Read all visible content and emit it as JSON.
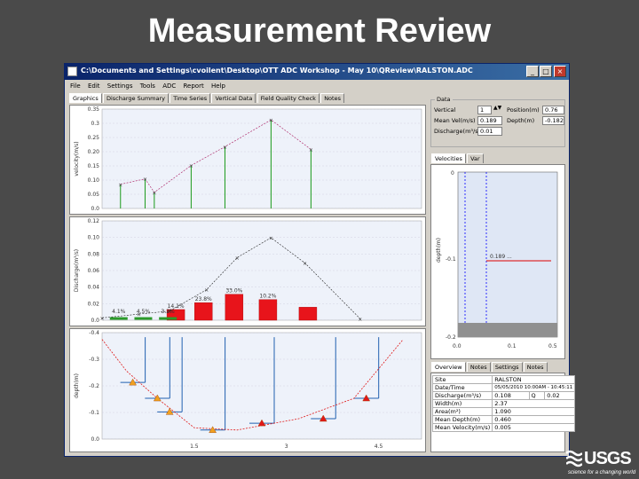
{
  "slide": {
    "title": "Measurement Review"
  },
  "window": {
    "title": "C:\\Documents and Settings\\cvoilent\\Desktop\\OTT ADC Workshop - May 10\\QReview\\RALSTON.ADC",
    "buttons": {
      "minimize": "_",
      "maximize": "□",
      "close": "×"
    }
  },
  "menu": [
    "File",
    "Edit",
    "Settings",
    "Tools",
    "ADC",
    "Report",
    "Help"
  ],
  "tabs": [
    "Graphics",
    "Discharge Summary",
    "Time Series",
    "Vertical Data",
    "Field Quality Check",
    "Notes"
  ],
  "right_top": {
    "group_label": "Data",
    "vertical_label": "Vertical",
    "vertical_value": "1",
    "position_label": "Position(m)",
    "position_value": "0.76",
    "mean_vel_label": "Mean Vel(m/s)",
    "mean_vel_value": "0.189",
    "depth_label": "Depth(m)",
    "depth_value": "-0.182",
    "discharge_label": "Discharge(m³/s)",
    "discharge_value": "0.01"
  },
  "velocity_tabs": [
    "Velocities",
    "Var"
  ],
  "velocity_plot": {
    "y_top": "0",
    "y_mid": "-0.1",
    "y_bot": "-0.2",
    "x_ticks": [
      "0.0",
      "0.1",
      "0.5"
    ],
    "ylabel": "depth(m)",
    "value_label": "0.189 ..."
  },
  "overview_tabs": [
    "Overview",
    "Notes",
    "Settings",
    "Notes"
  ],
  "overview": [
    {
      "label": "Site",
      "value": "RALSTON"
    },
    {
      "label": "Date/Time",
      "value": "05/05/2010 10:00AM - 10:45:11"
    },
    {
      "label": "Discharge(m³/s)",
      "value": "0.108",
      "extra_label": "Q",
      "extra_value": "0.02"
    },
    {
      "label": "Width(m)",
      "value": "2.37"
    },
    {
      "label": "Area(m²)",
      "value": "1.090"
    },
    {
      "label": "Mean Depth(m)",
      "value": "0.460"
    },
    {
      "label": "Mean Velocity(m/s)",
      "value": "0.005"
    }
  ],
  "chart_data": [
    {
      "type": "line",
      "ylabel": "velocity(m/s)",
      "yticks": [
        "0.0",
        "0.05",
        "0.10",
        "0.15",
        "0.20",
        "0.25",
        "0.3",
        "0.35"
      ],
      "ylim": [
        0,
        0.37
      ],
      "x": [
        0.3,
        0.7,
        0.85,
        1.45,
        2.0,
        2.75,
        3.4
      ],
      "values": [
        0.09,
        0.11,
        0.06,
        0.16,
        0.23,
        0.33,
        0.22
      ],
      "grid": true
    },
    {
      "type": "bar",
      "ylabel": "Discharge(m³/s)",
      "yticks": [
        "0.0",
        "0.02",
        "0.04",
        "0.06",
        "0.08",
        "0.10",
        "0.12"
      ],
      "ylim": [
        0,
        0.13
      ],
      "x": [
        1.2,
        1.65,
        2.15,
        2.7,
        3.35
      ],
      "values": [
        0.014,
        0.023,
        0.034,
        0.027,
        0.017
      ],
      "bar_labels": [
        "14.1%",
        "23.8%",
        "33.0%",
        "10.2%"
      ],
      "small_labels": [
        "4.1%",
        "4.5%",
        "3.2%"
      ],
      "line_x": [
        0.0,
        0.6,
        1.1,
        1.7,
        2.2,
        2.75,
        3.3,
        4.2
      ],
      "line_values": [
        0.003,
        0.008,
        0.012,
        0.04,
        0.082,
        0.108,
        0.075,
        0.002
      ]
    },
    {
      "type": "line",
      "ylabel": "depth(m)",
      "yticks": [
        "0.0",
        "-0.1",
        "-0.2",
        "-0.3",
        "-0.4"
      ],
      "ylim": [
        -0.45,
        0.02
      ],
      "xticks": [
        "1.5",
        "3",
        "4.5"
      ],
      "xlim": [
        0,
        5.2
      ],
      "x": [
        0.5,
        0.9,
        1.1,
        1.8,
        2.6,
        3.6,
        4.3
      ],
      "values": [
        -0.2,
        -0.27,
        -0.33,
        -0.41,
        -0.38,
        -0.36,
        -0.27
      ],
      "bed_line": [
        [
          0,
          -0.01
        ],
        [
          0.4,
          -0.15
        ],
        [
          0.9,
          -0.27
        ],
        [
          1.5,
          -0.4
        ],
        [
          2.2,
          -0.41
        ],
        [
          3.2,
          -0.36
        ],
        [
          4.1,
          -0.27
        ],
        [
          4.9,
          -0.01
        ]
      ]
    }
  ],
  "logo": {
    "word": "USGS",
    "tagline": "science for a changing world"
  }
}
